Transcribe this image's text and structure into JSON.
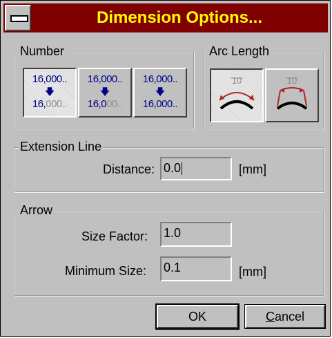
{
  "window": {
    "title": "Dimension Options..."
  },
  "number_group": {
    "legend": "Number",
    "buttons": [
      {
        "top": "16,000..",
        "bottom_main": "16,",
        "bottom_dim": "000..",
        "selected": true
      },
      {
        "top": "16,000..",
        "bottom_main": "16,0",
        "bottom_dim": "00..",
        "selected": false
      },
      {
        "top": "16,000..",
        "bottom_main": "16,000..",
        "bottom_dim": "",
        "selected": false
      }
    ]
  },
  "arc_group": {
    "legend": "Arc Length",
    "buttons": [
      {
        "label": "10",
        "selected": true
      },
      {
        "label": "10",
        "selected": false
      }
    ]
  },
  "extension_group": {
    "legend": "Extension Line",
    "distance_label": "Distance:",
    "distance_value": "0.0",
    "distance_unit": "[mm]"
  },
  "arrow_group": {
    "legend": "Arrow",
    "size_factor_label": "Size Factor:",
    "size_factor_value": "1.0",
    "minimum_size_label": "Minimum Size:",
    "minimum_size_value": "0.1",
    "minimum_size_unit": "[mm]"
  },
  "buttons": {
    "ok": "OK",
    "cancel_first": "C",
    "cancel_rest": "ancel"
  },
  "colors": {
    "title_bg": "#800000",
    "title_fg": "#ffff00",
    "face": "#c0c0c0",
    "number_text": "#00008b",
    "arc_red": "#b22222"
  }
}
